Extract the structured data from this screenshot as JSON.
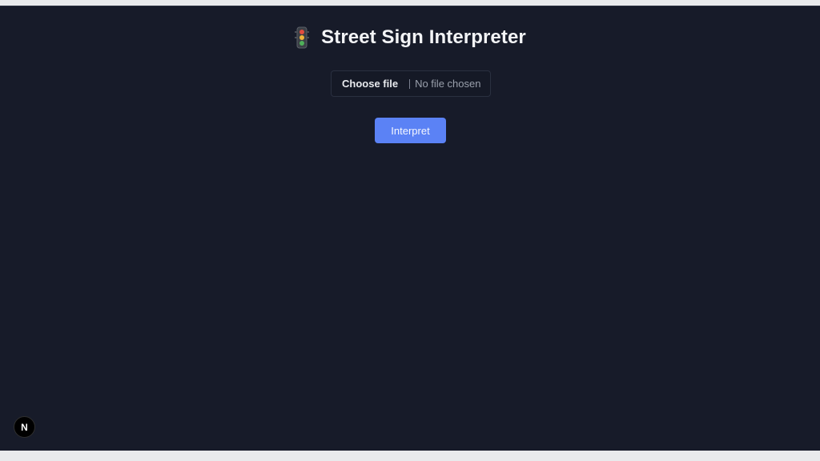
{
  "header": {
    "icon": "traffic-light-icon",
    "title": "Street Sign Interpreter"
  },
  "file_input": {
    "button_label": "Choose file",
    "status": "No file chosen"
  },
  "actions": {
    "interpret_label": "Interpret"
  },
  "dev_badge": {
    "icon": "nextjs-icon",
    "letter": "N"
  },
  "colors": {
    "background": "#171b29",
    "accent": "#5b82f5",
    "title_text": "#f3f4f6"
  }
}
